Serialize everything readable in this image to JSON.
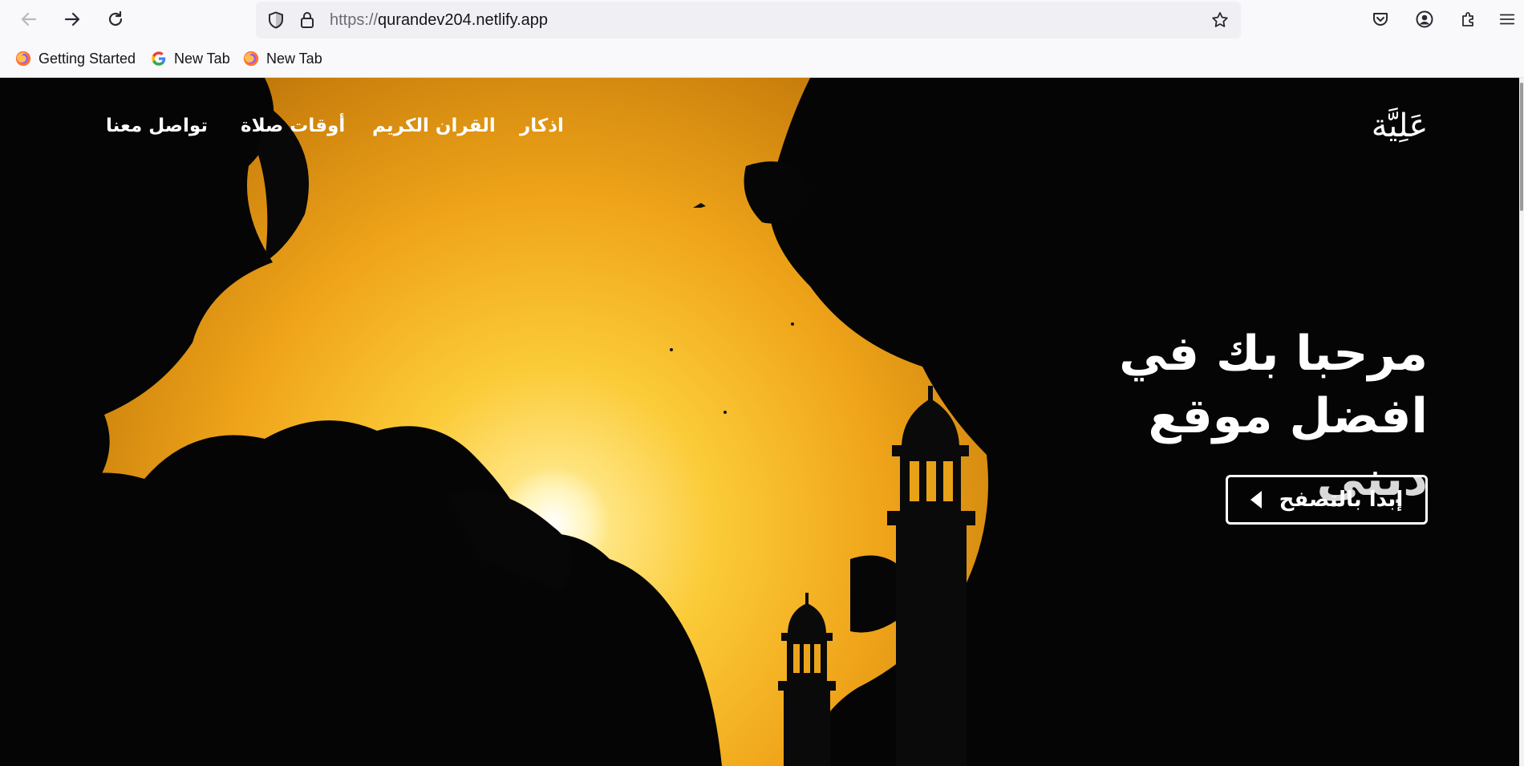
{
  "browser": {
    "url_scheme": "https://",
    "url_host": "qurandev204.netlify.app",
    "bookmarks": [
      {
        "label": "Getting Started",
        "icon": "firefox-icon"
      },
      {
        "label": "New Tab",
        "icon": "google-icon"
      },
      {
        "label": "New Tab",
        "icon": "firefox-icon"
      }
    ]
  },
  "site": {
    "logo": "عَلِيَّة",
    "nav": {
      "adhkar": "اذكار",
      "quran": "القران الكريم",
      "prayer_times": "أوقات صلاة",
      "contact": "تواصل معنا"
    },
    "hero": {
      "line1": "مرحبا بك في",
      "line2": "افضل موقع ديني",
      "cta_label": "إبدا بالتصفح"
    }
  },
  "colors": {
    "sky_center": "#ffe88a",
    "sky_mid": "#f3b21c",
    "sky_edge": "#b27008",
    "foliage": "#050505",
    "text": "#ffffff"
  }
}
